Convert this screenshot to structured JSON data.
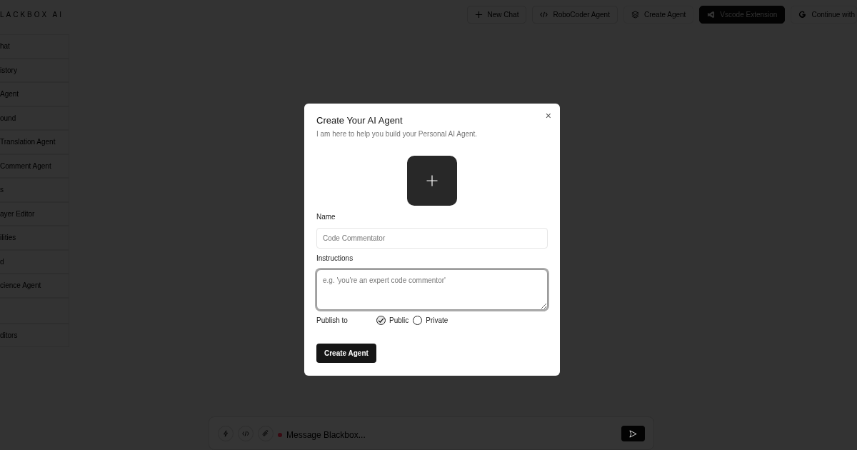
{
  "logo": "LACKBOX AI",
  "top_buttons": [
    {
      "label": "New Chat",
      "kind": "outline"
    },
    {
      "label": "RoboCoder Agent",
      "kind": "outline"
    },
    {
      "label": "Create Agent",
      "kind": "plain"
    },
    {
      "label": "Vscode Extension",
      "kind": "dark"
    },
    {
      "label": "Continue with",
      "kind": "plain"
    }
  ],
  "sidebar": {
    "items": [
      {
        "label": "hat"
      },
      {
        "label": "istory"
      },
      {
        "label": "Agent"
      },
      {
        "label": "ound"
      },
      {
        "label": "Translation Agent"
      },
      {
        "label": "Comment Agent"
      },
      {
        "label": "s"
      },
      {
        "label": "ayer Editor"
      },
      {
        "label": "ilities"
      },
      {
        "label": "d"
      },
      {
        "label": "cience Agent"
      },
      {
        "kind": "empty"
      },
      {
        "label": "ditors"
      }
    ]
  },
  "modal": {
    "close": "×",
    "title": "Create Your AI Agent",
    "subtitle": "I am here to help you build your Personal AI Agent.",
    "name_label": "Name",
    "name_placeholder": "Code Commentator",
    "instructions_label": "Instructions",
    "instructions_placeholder": "e.g. 'you're an expert code commentor'",
    "instructions_focused": true,
    "publish_label": "Publish to",
    "publish_options": [
      {
        "label": "Public",
        "selected": true
      },
      {
        "label": "Private",
        "selected": false
      }
    ],
    "submit": "Create Agent"
  },
  "chat_bar": {
    "placeholder": "Message Blackbox..."
  }
}
